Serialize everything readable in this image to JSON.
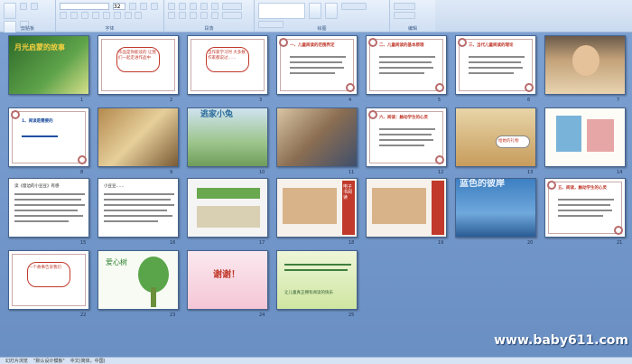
{
  "ribbon": {
    "groups": [
      "剪贴板",
      "字体",
      "段落",
      "绘图",
      "编辑"
    ],
    "font_combo_value": "",
    "size_combo_value": "32"
  },
  "slides": [
    {
      "n": "1",
      "kind": "title_image",
      "text": "月光启蒙的故事"
    },
    {
      "n": "2",
      "kind": "bubble",
      "text": "作品是你能读的 让我们一起走进作品中"
    },
    {
      "n": "3",
      "kind": "bubble",
      "text": "当作家学习时 大多数作家都说过……"
    },
    {
      "n": "4",
      "kind": "text_red",
      "text": "一、儿童阅读的范围界定"
    },
    {
      "n": "5",
      "kind": "text_red",
      "text": "二、儿童阅读的基本原理"
    },
    {
      "n": "6",
      "kind": "text_red",
      "text": "三、当代儿童阅读的理论"
    },
    {
      "n": "7",
      "kind": "photo_child",
      "text": ""
    },
    {
      "n": "8",
      "kind": "text_blue",
      "text": "1、阅读是需要的"
    },
    {
      "n": "9",
      "kind": "photo_art",
      "text": ""
    },
    {
      "n": "10",
      "kind": "book",
      "text": "逃家小兔"
    },
    {
      "n": "11",
      "kind": "photo_people",
      "text": ""
    },
    {
      "n": "12",
      "kind": "text_red",
      "text": "六、阅读：触动学生的心灵"
    },
    {
      "n": "13",
      "kind": "photo_group",
      "text": "给她的礼物"
    },
    {
      "n": "14",
      "kind": "photo_colorful",
      "text": ""
    },
    {
      "n": "15",
      "kind": "text_lines",
      "text": "读《窗边的小豆豆》有感"
    },
    {
      "n": "16",
      "kind": "text_lines",
      "text": "小豆豆……"
    },
    {
      "n": "17",
      "kind": "photo_green",
      "text": ""
    },
    {
      "n": "18",
      "kind": "red_banner",
      "text": "电子书阅读"
    },
    {
      "n": "19",
      "kind": "red_banner2",
      "text": ""
    },
    {
      "n": "20",
      "kind": "blue_photo",
      "text": "蓝色的彼岸"
    },
    {
      "n": "21",
      "kind": "text_red",
      "text": "五、阅读，触动学生的心灵"
    },
    {
      "n": "22",
      "kind": "bubble_text",
      "text": "一个故事告诉我们"
    },
    {
      "n": "23",
      "kind": "tree",
      "text": "爱心树"
    },
    {
      "n": "24",
      "kind": "thanks",
      "text": "谢谢！"
    },
    {
      "n": "25",
      "kind": "green_text",
      "text": "让儿童真正拥有阅读的快乐"
    }
  ],
  "status": {
    "slide_info": "幻灯片浏览",
    "theme": "\"默认设计模板\"",
    "lang": "中文(简体，中国)"
  },
  "watermark": "www.baby611.com",
  "colors": {
    "bg": "#6f93c6",
    "accent_red": "#c0392b",
    "accent_blue": "#1f4fa0"
  }
}
